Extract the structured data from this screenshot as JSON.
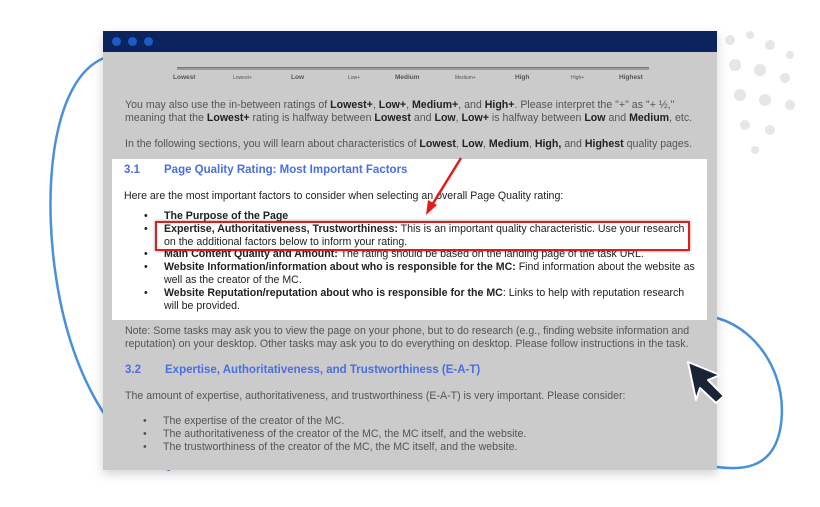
{
  "scale": [
    "Lowest",
    "Lowest+",
    "Low",
    "Low+",
    "Medium",
    "Medium+",
    "High",
    "High+",
    "Highest"
  ],
  "intro": {
    "l1a": "You may also use the in-between ratings of ",
    "l1b": "Lowest+",
    "l1c": ", ",
    "l1d": "Low+",
    "l1e": ", ",
    "l1f": "Medium+",
    "l1g": ", and ",
    "l1h": "High+",
    "l1i": ".  Please interpret the \"+\" as \"+ ½,\"",
    "l2a": "meaning that the ",
    "l2b": "Lowest+",
    "l2c": " rating is halfway between ",
    "l2d": "Lowest",
    "l2e": " and ",
    "l2f": "Low",
    "l2g": ", ",
    "l2h": "Low+",
    "l2i": " is halfway between ",
    "l2j": "Low",
    "l2k": " and ",
    "l2l": "Medium",
    "l2m": ", etc.",
    "l3a": "In the following sections, you will learn about characteristics of ",
    "l3b": "Lowest",
    "l3c": ", ",
    "l3d": "Low",
    "l3e": ", ",
    "l3f": "Medium",
    "l3g": ", ",
    "l3h": "High,",
    "l3i": " and ",
    "l3j": "Highest",
    "l3k": " quality pages."
  },
  "s31": {
    "num": "3.1",
    "title": "Page Quality Rating: Most Important Factors",
    "lead": "Here are the most important factors to consider when selecting an overall Page Quality rating:",
    "items": [
      {
        "b": "The Purpose of the Page",
        "t": ""
      },
      {
        "b": "Expertise, Authoritativeness, Trustworthiness:",
        "t": " This is an important quality characteristic.  Use your research",
        "t2": "on the additional factors below to inform your rating."
      },
      {
        "b": "Main Content Quality and Amount:",
        "t": " The rating should be based on the landing page of the task URL."
      },
      {
        "b": "Website Information/information about who is responsible for the MC:",
        "t": " Find information about the website as",
        "t2": "well as the creator of the MC."
      },
      {
        "b": "Website Reputation/reputation about who is responsible for the MC",
        "t": ": Links to help with reputation research",
        "t2": "will be provided."
      }
    ]
  },
  "note": {
    "l1": "Note: Some tasks may ask you to view the page on your phone, but to do research (e.g., finding website information and",
    "l2": "reputation) on your desktop.  Other tasks may ask you to do everything on desktop.  Please follow instructions in the task."
  },
  "s32": {
    "num": "3.2",
    "title": "Expertise, Authoritativeness, and Trustworthiness (E-A-T)",
    "lead": "The amount of expertise, authoritativeness, and trustworthiness (E-A-T) is very important.  Please consider:",
    "items": [
      "The expertise of the creator of the MC.",
      "The authoritativeness of the creator of the MC, the MC itself, and the website.",
      "The trustworthiness of the creator of the MC, the MC itself, and the website."
    ]
  },
  "colors": {
    "titlebar": "#0b245e",
    "heading": "#4a6fe0",
    "highlight": "#e41b1b",
    "curve": "#4a90d9"
  }
}
